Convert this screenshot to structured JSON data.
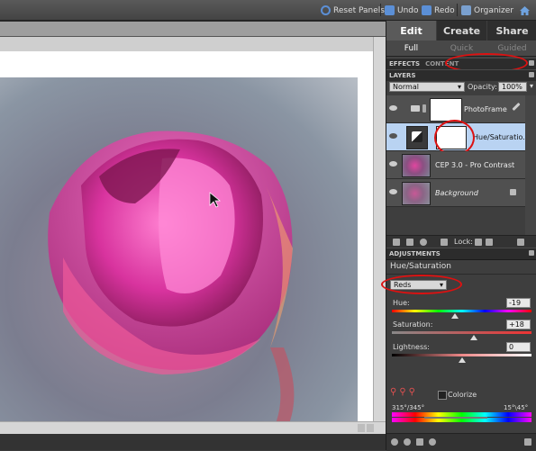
{
  "toolbar": {
    "reset_panels": "Reset Panels",
    "undo": "Undo",
    "redo": "Redo",
    "organizer": "Organizer"
  },
  "mode_tabs": {
    "edit": "Edit",
    "create": "Create",
    "share": "Share"
  },
  "sub_tabs": {
    "full": "Full",
    "quick": "Quick",
    "guided": "Guided"
  },
  "effects_panel": {
    "tab_effects": "EFFECTS",
    "tab_content": "CONTENT"
  },
  "layers_panel": {
    "title": "LAYERS",
    "blend_mode": "Normal",
    "opacity_label": "Opacity:",
    "opacity_value": "100%",
    "lock_label": "Lock:",
    "layers": [
      {
        "name": "PhotoFrame",
        "selected": false
      },
      {
        "name": "Hue/Saturatio...",
        "selected": true
      },
      {
        "name": "CEP 3.0 - Pro Contrast",
        "selected": false
      },
      {
        "name": "Background",
        "selected": false,
        "locked": true
      }
    ]
  },
  "adjustments_panel": {
    "title": "ADJUSTMENTS",
    "adjustment_name": "Hue/Saturation",
    "channel": "Reds",
    "hue_label": "Hue:",
    "hue_value": "-19",
    "hue_level": 0.45,
    "saturation_label": "Saturation:",
    "saturation_value": "+18",
    "saturation_level": 0.59,
    "lightness_label": "Lightness:",
    "lightness_value": "0",
    "lightness_level": 0.5,
    "colorize_label": "Colorize",
    "range_left": "315°/345°",
    "range_right": "15°\\45°"
  },
  "colors": {
    "accent": "#5b8fd6",
    "selected_layer": "#b9d3f2",
    "annotation": "#d11111"
  }
}
